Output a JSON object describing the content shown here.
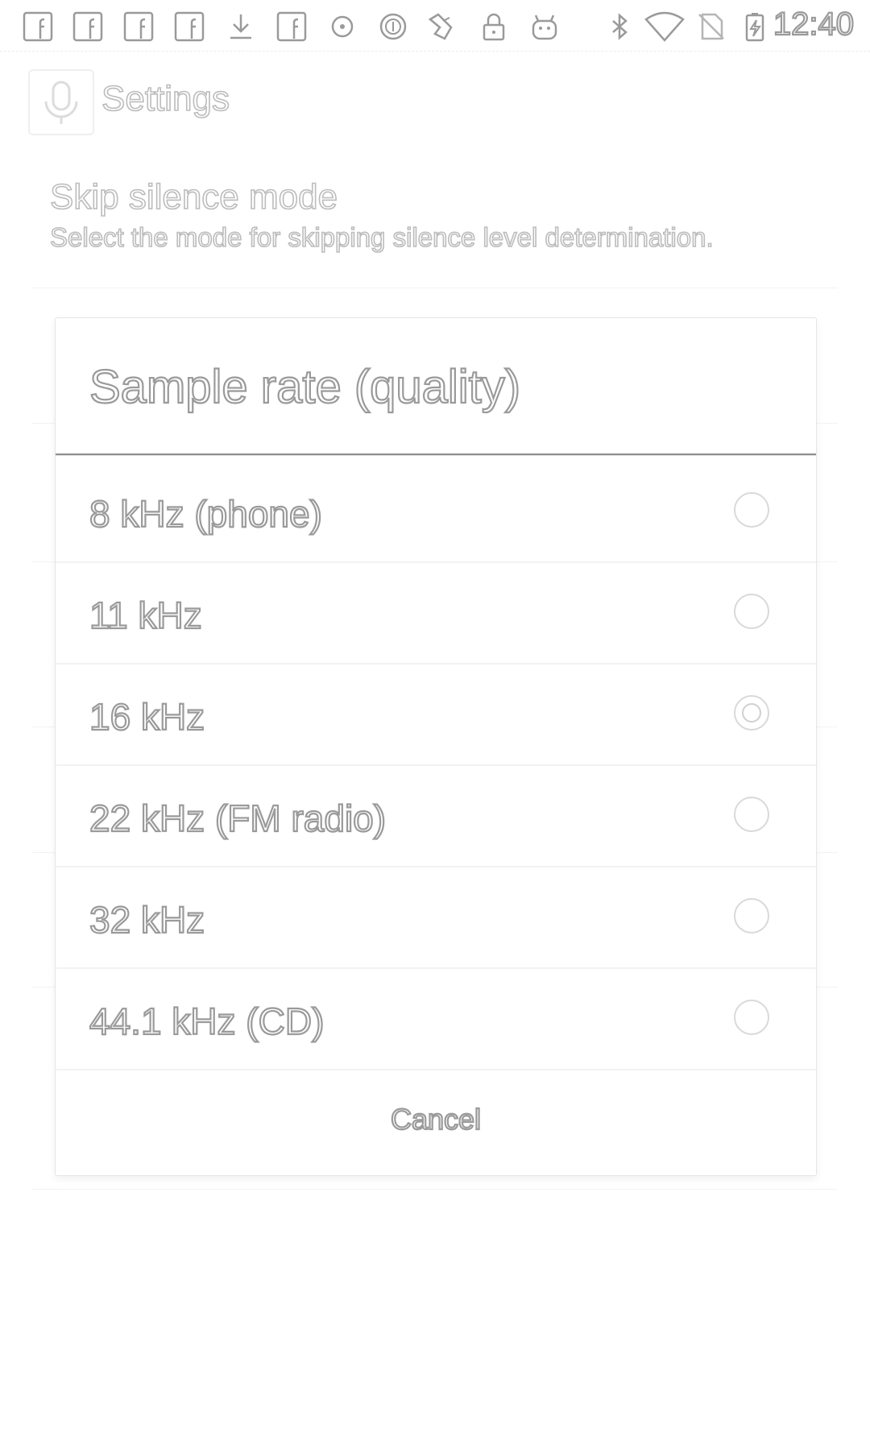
{
  "status_bar": {
    "time": "12:40",
    "icons": [
      "facebook-notification-icon",
      "facebook-notification-icon",
      "facebook-notification-icon",
      "facebook-notification-icon",
      "download-icon",
      "facebook-notification-icon",
      "record-dot-icon",
      "circle-badge-icon",
      "fast-app-icon",
      "lock-icon",
      "android-icon",
      "bluetooth-icon",
      "wifi-icon",
      "no-sim-icon",
      "battery-charging-icon"
    ]
  },
  "app_bar": {
    "title": "Settings",
    "icon": "microphone-icon"
  },
  "background_preference": {
    "title": "Skip silence mode",
    "summary": "Select the mode for skipping silence level determination."
  },
  "dialog": {
    "title": "Sample rate (quality)",
    "options": [
      {
        "label": "8 kHz (phone)",
        "selected": false
      },
      {
        "label": "11 kHz",
        "selected": false
      },
      {
        "label": "16 kHz",
        "selected": true
      },
      {
        "label": "22 kHz (FM radio)",
        "selected": false
      },
      {
        "label": "32 kHz",
        "selected": false
      },
      {
        "label": "44.1 kHz (CD)",
        "selected": false
      }
    ],
    "cancel_label": "Cancel"
  }
}
